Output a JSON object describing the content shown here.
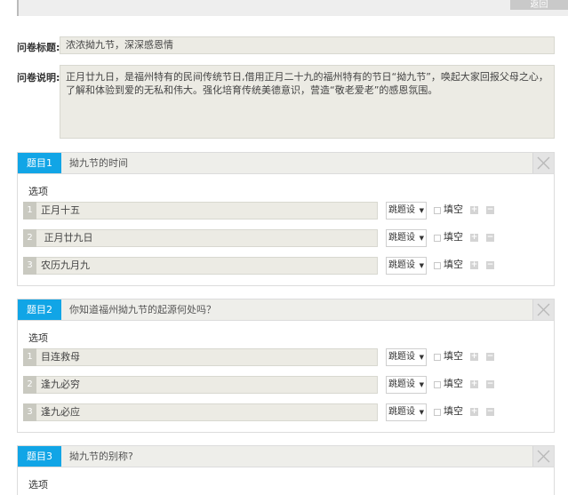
{
  "header": {
    "back_label": "返回"
  },
  "survey": {
    "title_label": "问卷标题:",
    "title_value": "浓浓拗九节，深深感恩情",
    "desc_label": "问卷说明:",
    "desc_value": "正月廿九日，是福州特有的民间传统节日,借用正月二十九的福州特有的节日“拗九节”，唤起大家回报父母之心，了解和体验到爱的无私和伟大。强化培育传统美德意识，营造“敬老爱老”的感恩氛围。"
  },
  "labels": {
    "options": "选项",
    "jump": "跳题设",
    "fill_blank": "填空",
    "add_icon": "+",
    "remove_icon": "−"
  },
  "questions": [
    {
      "number": "题目1",
      "title": "拗九节的时间",
      "options": [
        {
          "index": "1",
          "text": "正月十五"
        },
        {
          "index": "2",
          "text": " 正月廿九日"
        },
        {
          "index": "3",
          "text": "农历九月九"
        }
      ]
    },
    {
      "number": "题目2",
      "title": "你知道福州拗九节的起源何处吗？",
      "options": [
        {
          "index": "1",
          "text": "目连救母"
        },
        {
          "index": "2",
          "text": "逢九必穷"
        },
        {
          "index": "3",
          "text": "逢九必应"
        }
      ]
    },
    {
      "number": "题目3",
      "title": "拗九节的别称?",
      "options": []
    }
  ],
  "colors": {
    "accent": "#11a5e6",
    "field_bg": "#ecebe4",
    "header_bg": "#eeeeea"
  }
}
